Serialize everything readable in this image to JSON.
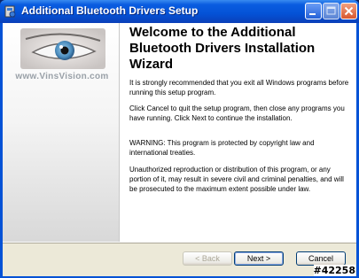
{
  "window": {
    "title": "Additional Bluetooth Drivers Setup"
  },
  "sidebar": {
    "brand": "www.VinsVision.com"
  },
  "content": {
    "heading": "Welcome to the Additional Bluetooth Drivers Installation Wizard",
    "paragraphs": [
      "It is strongly recommended that you exit all Windows programs before running this setup program.",
      "Click Cancel to quit the setup program, then close any programs you have running.  Click Next to continue the installation.",
      "WARNING: This program is protected by copyright law and international treaties.",
      "Unauthorized reproduction or distribution of this program, or any portion of it, may result in severe civil and criminal penalties, and will be prosecuted to the maximum extent possible under law."
    ]
  },
  "buttons": {
    "back": "< Back",
    "next": "Next >",
    "cancel": "Cancel"
  },
  "watermark": "#42258"
}
